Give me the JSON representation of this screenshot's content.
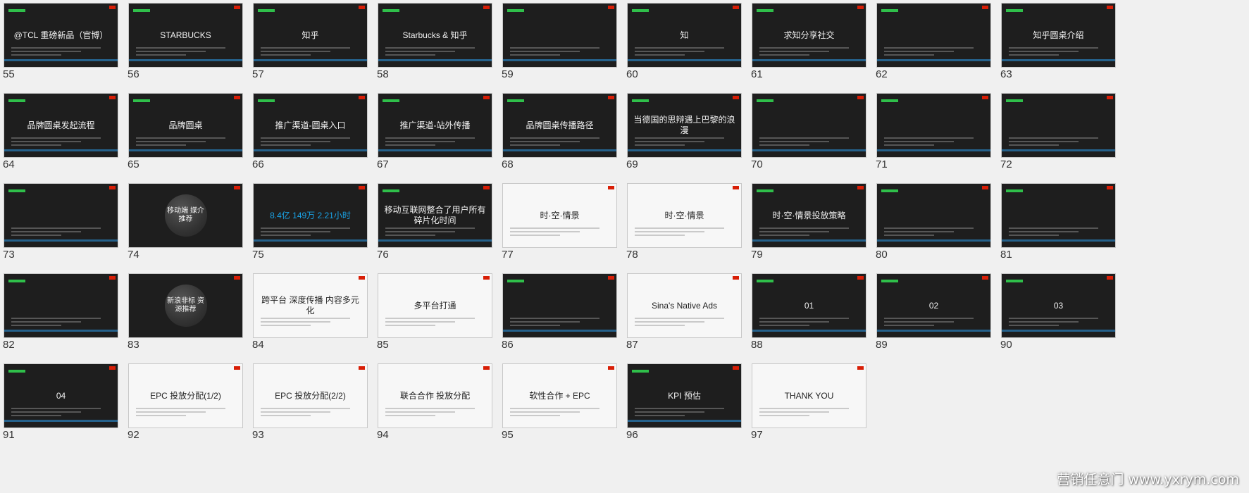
{
  "slides": [
    {
      "num": "55",
      "title": "@TCL 重磅新品（官博）",
      "theme": "dark"
    },
    {
      "num": "56",
      "title": "STARBUCKS",
      "theme": "dark"
    },
    {
      "num": "57",
      "title": "知乎",
      "theme": "dark"
    },
    {
      "num": "58",
      "title": "Starbucks & 知乎",
      "theme": "dark"
    },
    {
      "num": "59",
      "title": "",
      "theme": "dark"
    },
    {
      "num": "60",
      "title": "知",
      "theme": "dark"
    },
    {
      "num": "61",
      "title": "求知分享社交",
      "theme": "dark"
    },
    {
      "num": "62",
      "title": "",
      "theme": "dark"
    },
    {
      "num": "63",
      "title": "知乎圆桌介绍",
      "theme": "dark"
    },
    {
      "num": "64",
      "title": "品牌圆桌发起流程",
      "theme": "dark"
    },
    {
      "num": "65",
      "title": "品牌圆桌",
      "theme": "dark"
    },
    {
      "num": "66",
      "title": "推广渠道-圆桌入口",
      "theme": "dark"
    },
    {
      "num": "67",
      "title": "推广渠道-站外传播",
      "theme": "dark"
    },
    {
      "num": "68",
      "title": "品牌圆桌传播路径",
      "theme": "dark"
    },
    {
      "num": "69",
      "title": "当德国的思辩遇上巴黎的浪漫",
      "theme": "dark"
    },
    {
      "num": "70",
      "title": "",
      "theme": "dark"
    },
    {
      "num": "71",
      "title": "",
      "theme": "dark"
    },
    {
      "num": "72",
      "title": "",
      "theme": "dark"
    },
    {
      "num": "73",
      "title": "",
      "theme": "dark"
    },
    {
      "num": "74",
      "title": "移动端 媒介推荐",
      "theme": "circle"
    },
    {
      "num": "75",
      "title": "8.4亿  149万  2.21小时",
      "theme": "blue"
    },
    {
      "num": "76",
      "title": "移动互联网整合了用户所有碎片化时间",
      "theme": "dark"
    },
    {
      "num": "77",
      "title": "时·空·情景",
      "theme": "light"
    },
    {
      "num": "78",
      "title": "时·空·情景",
      "theme": "light"
    },
    {
      "num": "79",
      "title": "时·空·情景投放策略",
      "theme": "dark"
    },
    {
      "num": "80",
      "title": "",
      "theme": "dark"
    },
    {
      "num": "81",
      "title": "",
      "theme": "dark"
    },
    {
      "num": "82",
      "title": "",
      "theme": "dark"
    },
    {
      "num": "83",
      "title": "新浪非标 资源推荐",
      "theme": "circle"
    },
    {
      "num": "84",
      "title": "跨平台  深度传播  内容多元化",
      "theme": "light"
    },
    {
      "num": "85",
      "title": "多平台打通",
      "theme": "light"
    },
    {
      "num": "86",
      "title": "",
      "theme": "dark"
    },
    {
      "num": "87",
      "title": "Sina's Native Ads",
      "theme": "light"
    },
    {
      "num": "88",
      "title": "01",
      "theme": "dark"
    },
    {
      "num": "89",
      "title": "02",
      "theme": "dark"
    },
    {
      "num": "90",
      "title": "03",
      "theme": "dark"
    },
    {
      "num": "91",
      "title": "04",
      "theme": "dark"
    },
    {
      "num": "92",
      "title": "EPC 投放分配(1/2)",
      "theme": "light"
    },
    {
      "num": "93",
      "title": "EPC 投放分配(2/2)",
      "theme": "light"
    },
    {
      "num": "94",
      "title": "联合合作 投放分配",
      "theme": "light"
    },
    {
      "num": "95",
      "title": "软性合作 + EPC",
      "theme": "light"
    },
    {
      "num": "96",
      "title": "KPI 预估",
      "theme": "dark"
    },
    {
      "num": "97",
      "title": "THANK YOU",
      "theme": "light"
    }
  ],
  "watermark": "营销任意门 www.yxrym.com"
}
